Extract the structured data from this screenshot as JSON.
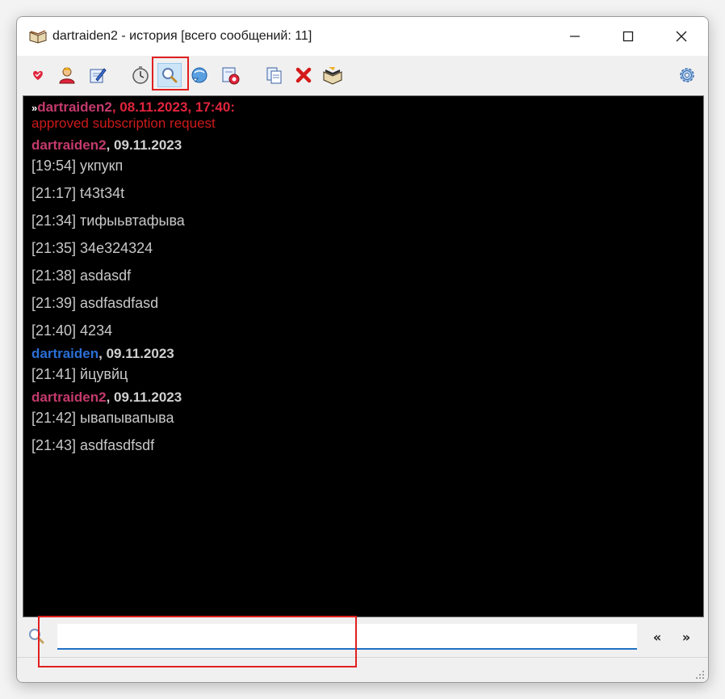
{
  "window": {
    "title": "dartraiden2 - история [всего сообщений: 11]",
    "controls": {
      "minimize": "—",
      "maximize": "☐",
      "close": "✕"
    }
  },
  "toolbar": {
    "items": [
      {
        "name": "user-details-icon"
      },
      {
        "name": "user-menu-icon"
      },
      {
        "name": "send-message-icon"
      },
      {
        "name": "timestamp-icon"
      },
      {
        "name": "search-icon",
        "active": true
      },
      {
        "name": "filter-icon"
      },
      {
        "name": "delete-history-icon"
      },
      {
        "name": "copy-icon"
      },
      {
        "name": "delete-icon"
      },
      {
        "name": "history-book-icon"
      },
      {
        "name": "options-gear-icon"
      }
    ]
  },
  "log": {
    "event": {
      "arrow": "»",
      "nick": "dartraiden2",
      "datetime": ", 08.11.2023, 17:40:",
      "text": "approved subscription request"
    },
    "groups": [
      {
        "nick": "dartraiden2",
        "nick_style": "a",
        "date": ", 09.11.2023",
        "messages": [
          "[19:54] укпукп",
          "[21:17] t43t34t",
          "[21:34] тифыьвтафыва",
          "[21:35] 34e324324",
          "[21:38] asdasdf",
          "[21:39] asdfasdfasd",
          "[21:40] 4234"
        ]
      },
      {
        "nick": "dartraiden",
        "nick_style": "b",
        "date": ", 09.11.2023",
        "messages": [
          "[21:41] йцувйц"
        ]
      },
      {
        "nick": "dartraiden2",
        "nick_style": "a",
        "date": ", 09.11.2023",
        "messages": [
          "[21:42] ывапывапыва",
          "[21:43] asdfasdfsdf"
        ]
      }
    ]
  },
  "search": {
    "value": "",
    "prev_label": "«",
    "next_label": "»"
  },
  "colors": {
    "accent": "#1f6fc5",
    "nick_self": "#c43a6c",
    "nick_other": "#2a6fd6",
    "event": "#cc1a1a",
    "highlight": "#e02020"
  }
}
